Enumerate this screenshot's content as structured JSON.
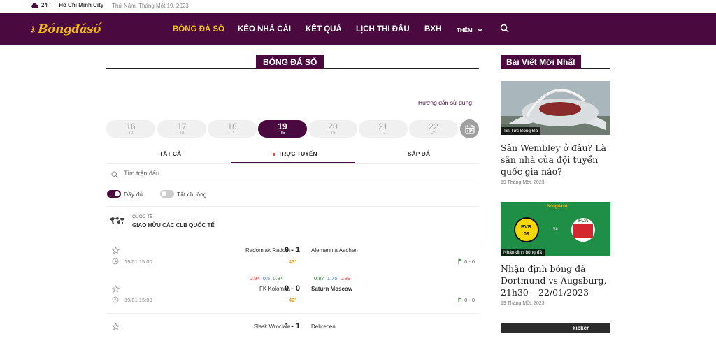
{
  "topbar": {
    "temperature": "24",
    "temp_unit": "C",
    "city": "Ho Chi Minh City",
    "date": "Thứ Năm, Tháng Một 19, 2023"
  },
  "nav": {
    "logo": "Bóngđásố",
    "items": [
      {
        "label": "BÓNG ĐÁ SỐ",
        "active": true
      },
      {
        "label": "KÈO NHÀ CÁI",
        "active": false
      },
      {
        "label": "KẾT QUẢ",
        "active": false
      },
      {
        "label": "LỊCH THI ĐẤU",
        "active": false
      },
      {
        "label": "BXH",
        "active": false
      }
    ],
    "more_label": "THÊM",
    "accent": "#f2c21b",
    "bg": "#4a0a3f"
  },
  "main": {
    "section_title": "BÓNG ĐÁ SỐ",
    "guide_link": "Hướng dẫn sử dụng",
    "dates": [
      {
        "num": "16",
        "day": "T2",
        "active": false
      },
      {
        "num": "17",
        "day": "T3",
        "active": false
      },
      {
        "num": "18",
        "day": "T4",
        "active": false
      },
      {
        "num": "19",
        "day": "T5",
        "active": true
      },
      {
        "num": "20",
        "day": "T6",
        "active": false
      },
      {
        "num": "21",
        "day": "T7",
        "active": false
      },
      {
        "num": "22",
        "day": "CN",
        "active": false
      }
    ],
    "tabs": [
      {
        "label": "TẤT CẢ"
      },
      {
        "label": "TRỰC TUYẾN"
      },
      {
        "label": "SẮP ĐÁ"
      }
    ],
    "search_placeholder": "Tìm trận đấu",
    "toggles": [
      {
        "label": "Đầy đủ",
        "on": true
      },
      {
        "label": "Tắt chuông",
        "on": false
      }
    ],
    "league": {
      "country": "QUỐC TẾ",
      "name": "GIAO HỮU CÁC CLB QUỐC TẾ"
    },
    "matches": [
      {
        "home": "Radomiak Radom",
        "away": "Alemannia Aachen",
        "away_bold": false,
        "score": "0 - 1",
        "minute": "43'",
        "time": "19/01 15:00",
        "corners": "0 - 0",
        "odds": null
      },
      {
        "home": "FK Kolomna",
        "away": "Saturn Moscow",
        "away_bold": true,
        "score": "0 - 0",
        "minute": "42'",
        "time": "19/01 15:00",
        "corners": "0 - 0",
        "odds": {
          "a": "0.94",
          "b": "0.5",
          "c": "0.84",
          "d": "0.87",
          "e": "1.75",
          "f": "0.89"
        }
      },
      {
        "home": "Slask Wroclaw",
        "away": "Debrecen",
        "away_bold": false,
        "score": "1 - 1",
        "minute": "",
        "time": "",
        "corners": "",
        "odds": null
      }
    ]
  },
  "sidebar": {
    "title": "Bài Viết Mới Nhất",
    "articles": [
      {
        "category": "Tin Tức Bóng Đá",
        "title": "Sân Wembley ở đâu? Là sân nhà của đội tuyển quốc gia nào?",
        "date": "19 Tháng Một, 2023"
      },
      {
        "category": "Nhận định bóng đá",
        "title": "Nhận định bóng đá Dortmund vs Augsburg, 21h30 – 22/01/2023",
        "date": "19 Tháng Một, 2023",
        "thumb_logo": "Bóngđásố",
        "thumb_vs": "vs",
        "bvb_text": "BVB",
        "bvb_year": "09",
        "fca_text": "FCA"
      },
      {
        "thumb_text": "kicker"
      }
    ]
  }
}
